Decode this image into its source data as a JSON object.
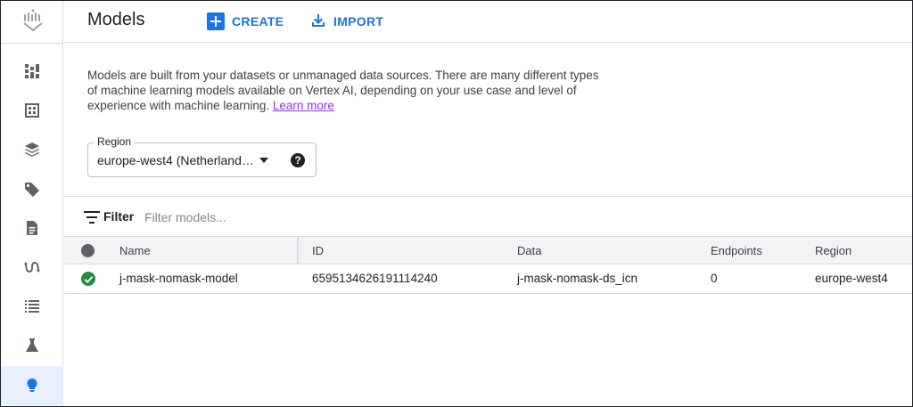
{
  "header": {
    "title": "Models",
    "create_label": "CREATE",
    "import_label": "IMPORT"
  },
  "description": {
    "text": "Models are built from your datasets or unmanaged data sources. There are many different types of machine learning models available on Vertex AI, depending on your use case and level of experience with machine learning.",
    "link_label": "Learn more"
  },
  "region": {
    "label": "Region",
    "value": "europe-west4 (Netherland…"
  },
  "filter": {
    "label": "Filter",
    "placeholder": "Filter models..."
  },
  "table": {
    "columns": [
      "Name",
      "ID",
      "Data",
      "Endpoints",
      "Region"
    ],
    "rows": [
      {
        "status": "ok",
        "name": "j-mask-nomask-model",
        "id": "6595134626191114240",
        "data": "j-mask-nomask-ds_icn",
        "endpoints": "0",
        "region": "europe-west4"
      }
    ]
  },
  "sidebar": {
    "items": [
      "dashboard-icon",
      "datasets-icon",
      "features-icon",
      "labeling-icon",
      "notebooks-icon",
      "pipelines-icon",
      "training-icon",
      "experiments-icon",
      "models-icon"
    ],
    "active": "models-icon"
  },
  "colors": {
    "accent": "#1a73e8",
    "success": "#1e8e3e",
    "link": "#9334e6"
  }
}
